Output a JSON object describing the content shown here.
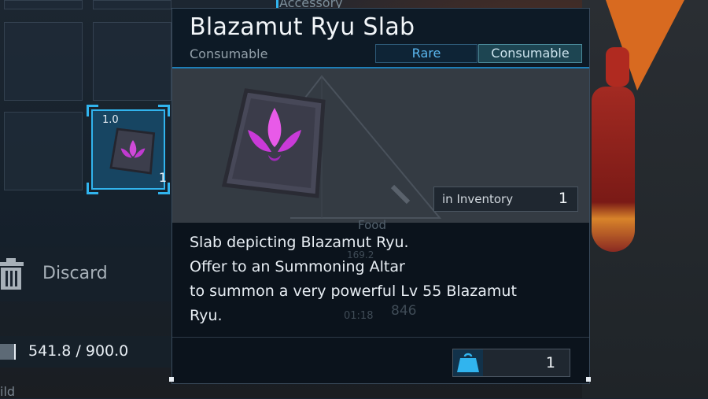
{
  "item": {
    "name": "Blazamut Ryu Slab",
    "category": "Consumable",
    "rarity_tag": "Rare",
    "type_tag": "Consumable",
    "in_inventory_label": "in Inventory",
    "in_inventory_count": "1",
    "description_lines": [
      "Slab depicting Blazamut Ryu.",
      "Offer to an Summoning Altar",
      "to summon a very powerful Lv 55 Blazamut",
      "Ryu."
    ],
    "quantity": "1"
  },
  "inventory": {
    "selected_slot": {
      "weight": "1.0",
      "count": "1"
    },
    "discard_label": "Discard",
    "carry_weight": "541.8 / 900.0",
    "tab_accessory": "Accessory",
    "bottom_text": "ild"
  },
  "background_text": {
    "food": "Food",
    "num1": "169.2",
    "num2": "846",
    "time": "01:18"
  },
  "colors": {
    "accent": "#31b4ee",
    "rare": "#5ab7ef",
    "slab_glow": "#d04ad8"
  },
  "icons": {
    "trash": "trash-icon",
    "bag": "bag-icon",
    "slab": "slab-icon"
  }
}
